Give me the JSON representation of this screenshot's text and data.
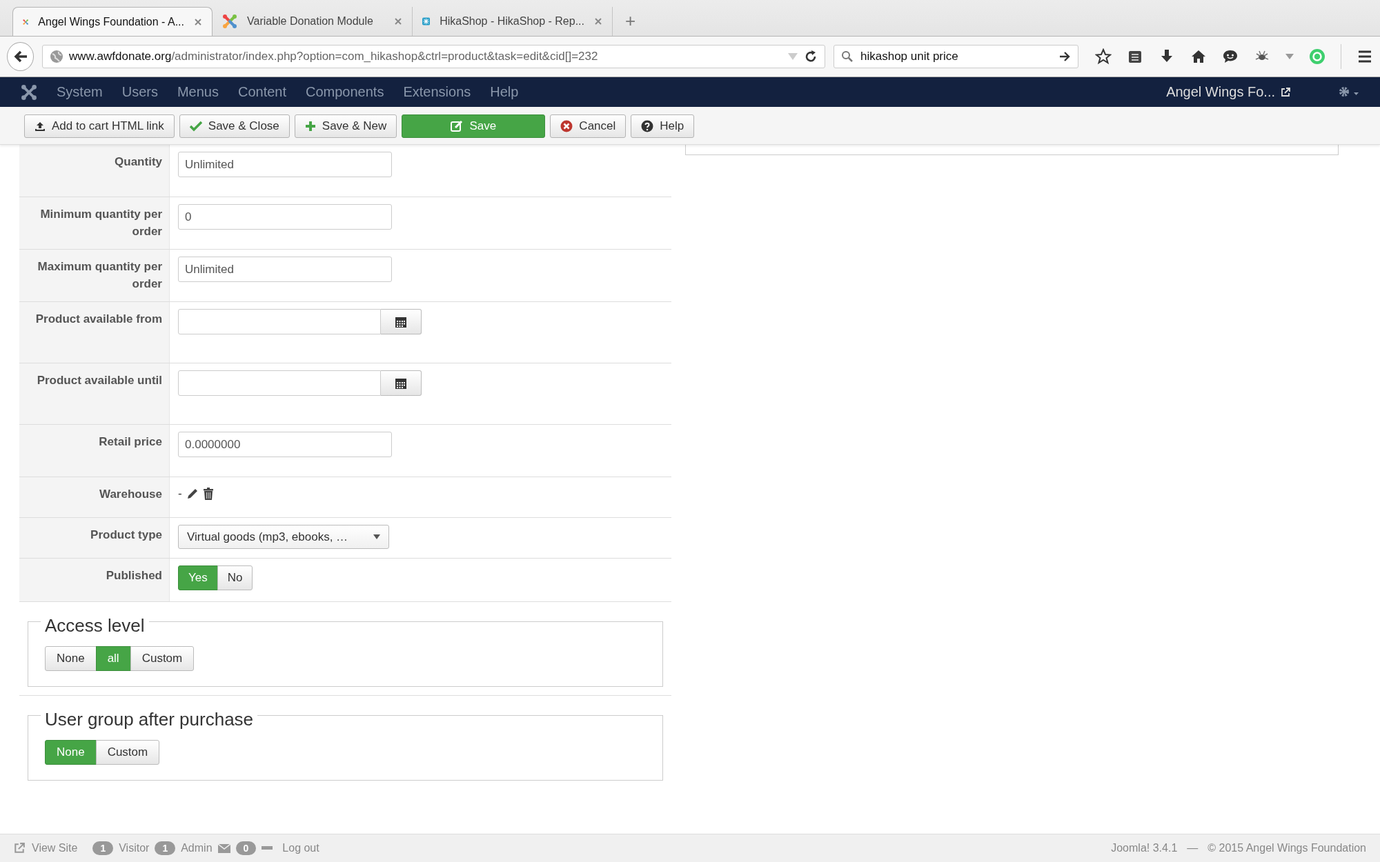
{
  "browser": {
    "tabs": [
      {
        "title": "Angel Wings Foundation - A...",
        "selected": true
      },
      {
        "title": "Variable Donation Module",
        "selected": false
      },
      {
        "title": "HikaShop - HikaShop - Rep...",
        "selected": false
      }
    ],
    "new_tab": "+",
    "address": {
      "domain": "www.awfdonate.org",
      "path": "/administrator/index.php?option=com_hikashop&ctrl=product&task=edit&cid[]=232"
    },
    "search": {
      "value": "hikashop unit price"
    }
  },
  "nav": {
    "items": [
      "System",
      "Users",
      "Menus",
      "Content",
      "Components",
      "Extensions",
      "Help"
    ],
    "site_name": "Angel Wings Fo..."
  },
  "toolbar": [
    {
      "label": "Add to cart HTML link",
      "kind": "default"
    },
    {
      "label": "Save & Close",
      "kind": "default"
    },
    {
      "label": "Save & New",
      "kind": "default"
    },
    {
      "label": "Save",
      "kind": "primary"
    },
    {
      "label": "Cancel",
      "kind": "default"
    },
    {
      "label": "Help",
      "kind": "default"
    }
  ],
  "form": {
    "rows": [
      {
        "label": "Quantity",
        "kind": "text",
        "value": "Unlimited"
      },
      {
        "label": "Minimum quantity per order",
        "kind": "text",
        "value": "0"
      },
      {
        "label": "Maximum quantity per order",
        "kind": "text",
        "value": "Unlimited"
      },
      {
        "label": "Product available from",
        "kind": "date"
      },
      {
        "label": "Product available until",
        "kind": "date"
      },
      {
        "label": "Retail price",
        "kind": "text",
        "value": "0.0000000"
      },
      {
        "label": "Warehouse",
        "kind": "warehouse",
        "value": "-"
      },
      {
        "label": "Product type",
        "kind": "select",
        "value": "Virtual goods (mp3, ebooks, …"
      },
      {
        "label": "Published",
        "kind": "toggle",
        "options": [
          {
            "label": "Yes",
            "selected": true
          },
          {
            "label": "No",
            "selected": false
          }
        ]
      }
    ]
  },
  "access_level": {
    "legend": "Access level",
    "options": [
      {
        "label": "None",
        "selected": false
      },
      {
        "label": "all",
        "selected": true
      },
      {
        "label": "Custom",
        "selected": false
      }
    ]
  },
  "user_group": {
    "legend": "User group after purchase",
    "options": [
      {
        "label": "None",
        "selected": true
      },
      {
        "label": "Custom",
        "selected": false
      }
    ]
  },
  "footer": {
    "view_site": "View Site",
    "visitors": "1",
    "visitor_label": "Visitor",
    "admins": "1",
    "admin_label": "Admin",
    "messages": "0",
    "logout": "Log out",
    "version": "Joomla! 3.4.1",
    "separator": "—",
    "copyright": "© 2015 Angel Wings Foundation"
  }
}
